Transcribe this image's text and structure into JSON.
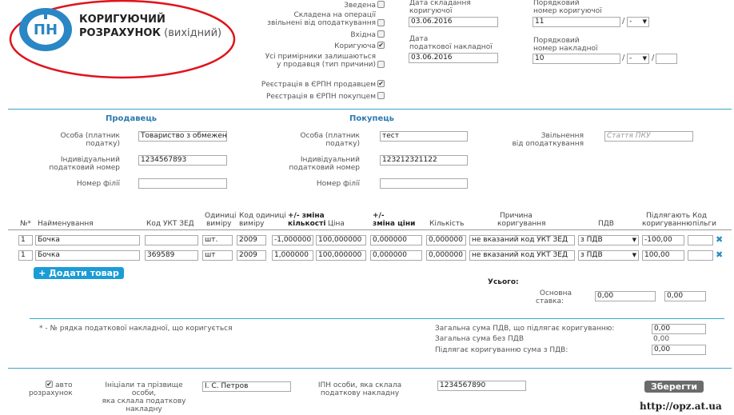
{
  "logo": {
    "text": "ПН"
  },
  "header": {
    "title_line1": "КОРИГУЮЧИЙ",
    "title_line2_bold": "РОЗРАХУНОК",
    "title_line2_rest": " (вихідний)",
    "flags": {
      "zvedena": "Зведена",
      "operations_l1": "Складена на операції",
      "operations_l2": "звільнені від оподаткування",
      "vkhidna": "Вхідна",
      "koryhuyucha": "Коригуюча",
      "copies_l1": "Усі примірники залишаються",
      "copies_l2": "у продавця (тип причини)",
      "erpn_seller": "Реєстрація в ЄРПН продавцем",
      "erpn_buyer": "Реєстрація в ЄРПН покупцем"
    },
    "date_corr_l1": "Дата складання",
    "date_corr_l2": "коригуючої",
    "date_corr_value": "03.06.2016",
    "date_inv_l1": "Дата",
    "date_inv_l2": "податкової накладної",
    "date_inv_value": "03.06.2016",
    "num_corr_l1": "Порядковий",
    "num_corr_l2": "номер коригуючої",
    "num_corr_value": "11",
    "num_inv_l1": "Порядковий",
    "num_inv_l2": "номер накладної",
    "num_inv_value": "10",
    "select_dash": "-"
  },
  "seller": {
    "heading": "Продавець",
    "person_l1": "Особа (платник",
    "person_l2": "податку)",
    "person_value": "Товариство з обмежен",
    "ipn_l1": "Індивідуальний",
    "ipn_l2": "податковий номер",
    "ipn_value": "1234567893",
    "branch": "Номер філії"
  },
  "buyer": {
    "heading": "Покупець",
    "person_l1": "Особа (платник",
    "person_l2": "податку)",
    "person_value": "тест",
    "ipn_l1": "Індивідуальний",
    "ipn_l2": "податковий номер",
    "ipn_value": "123212321122",
    "branch": "Номер філії",
    "exempt_l1": "Звільнення",
    "exempt_l2": "від оподаткування",
    "exempt_placeholder": "Стаття ПКУ"
  },
  "table": {
    "h_num": "№*",
    "h_name": "Найменування",
    "h_uktzed": "Код УКТ ЗЕД",
    "h_unit_l1": "Одиниці",
    "h_unit_l2": "виміру",
    "h_unitcode_l1": "Код одиниці",
    "h_unitcode_l2": "виміру",
    "h_qtychange_l1": "+/- зміна",
    "h_qtychange_l2": "кількості",
    "h_price": "Ціна",
    "h_pricechange_l1": "+/-",
    "h_pricechange_l2": "зміна ціни",
    "h_qty": "Кількість",
    "h_reason_l1": "Причина",
    "h_reason_l2": "коригування",
    "h_vat": "ПДВ",
    "h_subject_l1": "Підлягають",
    "h_subject_l2": "коригуванню",
    "h_benefit_l1": "Код",
    "h_benefit_l2": "пільги",
    "rows": [
      {
        "num": "1",
        "name": "Бочка",
        "uktzed": "",
        "unit": "шт.",
        "unitcode": "2009",
        "qtychange": "-1,000000",
        "price": "100,000000",
        "pricechange": "0,000000",
        "qty": "0,000000",
        "reason": "не вказаний код УКТ ЗЕД",
        "vat": "з ПДВ",
        "subject": "-100,00",
        "benefit": ""
      },
      {
        "num": "1",
        "name": "Бочка",
        "uktzed": "369589",
        "unit": "шт",
        "unitcode": "2009",
        "qtychange": "1,000000",
        "price": "100,000000",
        "pricechange": "0,000000",
        "qty": "0,000000",
        "reason": "не вказаний код УКТ ЗЕД",
        "vat": "з ПДВ",
        "subject": "100,00",
        "benefit": ""
      }
    ],
    "delete_glyph": "✖"
  },
  "add_button": "+ Додати товар",
  "totals": {
    "heading": "Усього:",
    "basic_l1": "Основна",
    "basic_l2": "ставка:",
    "basic_v1": "0,00",
    "basic_v2": "0,00"
  },
  "footnote": "* - № рядка податкової накладної, що коригується",
  "summary": {
    "vat_total_label": "Загальна сума ПДВ, що підлягає коригуванню:",
    "vat_total_value": "0,00",
    "without_vat_label": "Загальна сума без ПДВ",
    "without_vat_value": "0,00",
    "with_vat_label": "Підлягає коригуванню сума з ПДВ:",
    "with_vat_value": "0,00"
  },
  "footer": {
    "auto_l1": "авто",
    "auto_l2": "розрахунок",
    "initials_l1": "Ініціали та прізвище",
    "initials_l2": "особи,",
    "initials_l3": "яка склала податкову",
    "initials_l4": "накладну",
    "initials_value": "І. С. Петров",
    "ipn_l1": "ІПН особи, яка склала",
    "ipn_l2": "податкову накладну",
    "ipn_value": "1234567890",
    "save": "Зберегти"
  },
  "watermark": "http://opz.at.ua",
  "colors": {
    "accent": "#1a9cd6",
    "logo_blue": "#2a86c4",
    "annotation_red": "#e0141b",
    "save_gray": "#6b6b6b"
  }
}
